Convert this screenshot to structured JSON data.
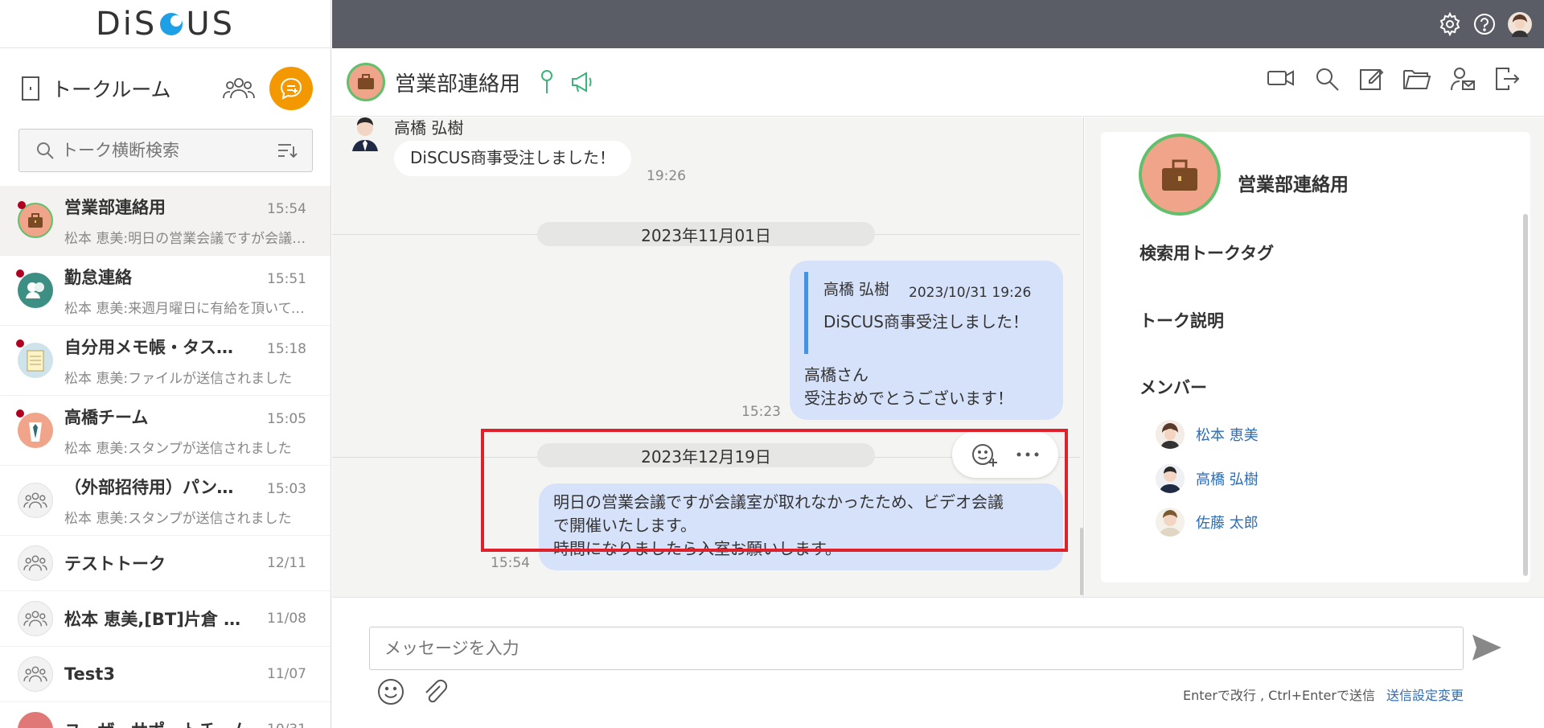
{
  "app": {
    "logo_left": "DiS",
    "logo_right": "US"
  },
  "sidebar": {
    "title": "トークルーム",
    "search_placeholder": "トーク横断検索",
    "rooms": [
      {
        "name": "営業部連絡用",
        "time": "15:54",
        "last": "松本 恵美:明日の営業会議ですが会議室が取れなかったため",
        "unread": true,
        "active": true,
        "icon": "briefcase-icon"
      },
      {
        "name": "勤怠連絡",
        "time": "15:51",
        "last": "松本 恵美:来週月曜日に有給を頂いてもよろしいでしょうか",
        "unread": true,
        "icon": "people-icon"
      },
      {
        "name": "自分用メモ帳・タスク管理",
        "time": "15:18",
        "last": "松本 恵美:ファイルが送信されました",
        "unread": true,
        "icon": "notepad-icon"
      },
      {
        "name": "高橋チーム",
        "time": "15:05",
        "last": "松本 恵美:スタンプが送信されました",
        "unread": true,
        "icon": "suit-icon"
      },
      {
        "name": "（外部招待用）パンフレット制作",
        "time": "15:03",
        "last": "松本 恵美:スタンプが送信されました",
        "unread": false,
        "icon": "group-icon"
      },
      {
        "name": "テストトーク",
        "time": "12/11",
        "last": "",
        "unread": false,
        "icon": "group-icon"
      },
      {
        "name": "松本 恵美,[BT]片倉 隆太",
        "time": "11/08",
        "last": "",
        "unread": false,
        "icon": "group-icon"
      },
      {
        "name": "Test3",
        "time": "11/07",
        "last": "",
        "unread": false,
        "icon": "group-icon"
      },
      {
        "name": "ユーザーサポートチーム",
        "time": "10/31",
        "last": "",
        "unread": false,
        "icon": "group-icon"
      }
    ]
  },
  "header": {
    "room_title": "営業部連絡用"
  },
  "chat": {
    "msg1": {
      "sender": "高橋 弘樹",
      "text": "DiSCUS商事受注しました！",
      "time": "19:26"
    },
    "date1": "2023年11月01日",
    "msg2": {
      "quote_sender": "高橋 弘樹",
      "quote_time": "2023/10/31 19:26",
      "quote_text": "DiSCUS商事受注しました！",
      "line1": "高橋さん",
      "line2": "受注おめでとうございます！",
      "time": "15:23"
    },
    "date2": "2023年12月19日",
    "msg3": {
      "line1": "明日の営業会議ですが会議室が取れなかったため、ビデオ会議",
      "line2": "で開催いたします。",
      "line3": "時間になりましたら入室お願いします。",
      "time": "15:54"
    }
  },
  "detail": {
    "room_name": "営業部連絡用",
    "tags_label": "検索用トークタグ",
    "desc_label": "トーク説明",
    "members_label": "メンバー",
    "members": [
      "松本 恵美",
      "高橋 弘樹",
      "佐藤 太郎"
    ]
  },
  "input": {
    "placeholder": "メッセージを入力",
    "hint": "Enterで改行 , Ctrl+Enterで送信",
    "settings_link": "送信設定変更"
  },
  "colors": {
    "accent_orange": "#f39800",
    "topbar": "#5a5d66",
    "bubble_blue": "#d6e2fa",
    "highlight_red": "#e0202a",
    "logo_blue": "#1ea0e6"
  }
}
